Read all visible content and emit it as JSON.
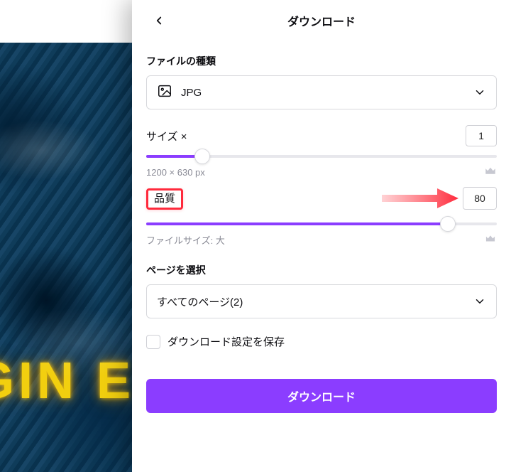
{
  "header": {
    "title": "ダウンロード"
  },
  "filetype": {
    "label": "ファイルの種類",
    "selected": "JPG"
  },
  "size": {
    "label": "サイズ ×",
    "value": "1",
    "dimensions": "1200 × 630 px",
    "slider_pct": 16
  },
  "quality": {
    "label": "品質",
    "value": "80",
    "filesize_text": "ファイルサイズ: 大",
    "slider_pct": 86
  },
  "pages": {
    "label": "ページを選択",
    "selected": "すべてのページ(2)"
  },
  "save_settings": {
    "label": "ダウンロード設定を保存"
  },
  "actions": {
    "download": "ダウンロード"
  },
  "canvas": {
    "sample_text": "GIN E"
  }
}
